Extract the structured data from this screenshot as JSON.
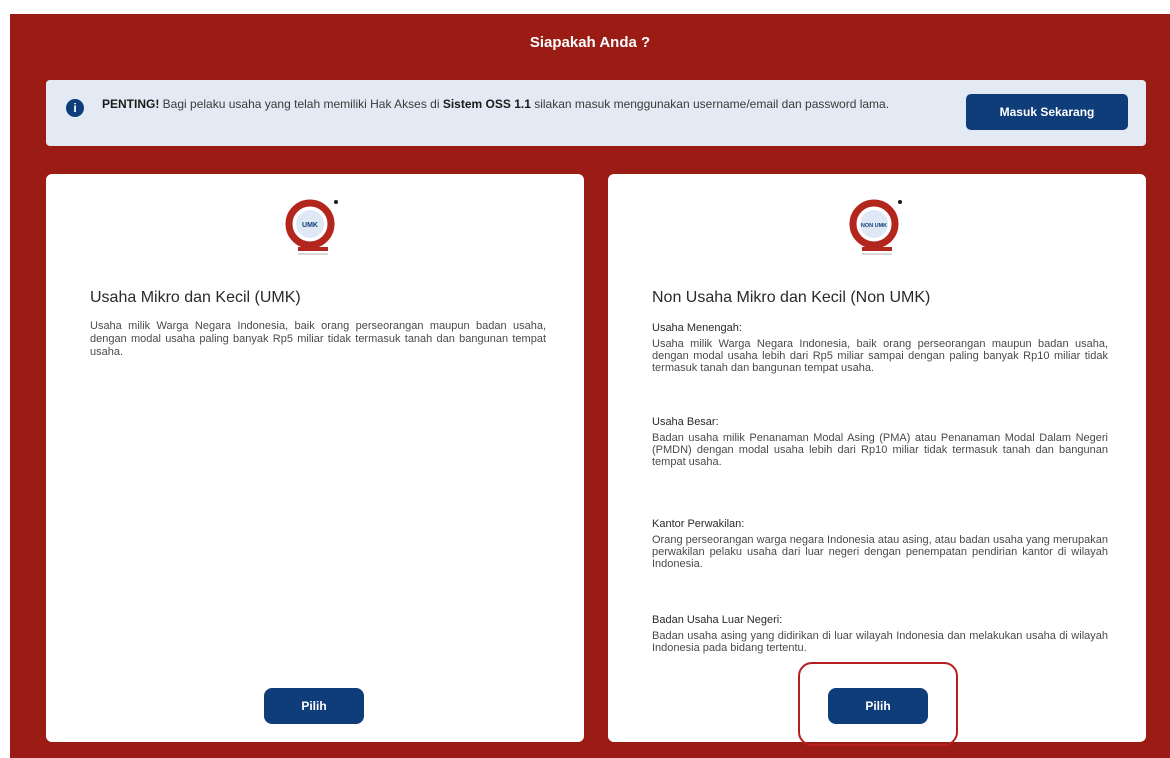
{
  "header": {
    "title": "Siapakah Anda ?"
  },
  "notice": {
    "icon": "info-icon",
    "prefix": "PENTING!",
    "text_before": " Bagi pelaku usaha yang telah memiliki Hak Akses di ",
    "system_name": "Sistem OSS 1.1",
    "text_after": " silakan masuk menggunakan username/email dan password lama.",
    "button_label": "Masuk Sekarang"
  },
  "cards": [
    {
      "logo": "umk-logo",
      "logo_text": "UMK",
      "title": "Usaha Mikro dan Kecil (UMK)",
      "description": "Usaha milik Warga Negara Indonesia, baik orang perseorangan maupun badan usaha, dengan modal usaha paling banyak Rp5 miliar tidak termasuk tanah dan bangunan tempat usaha.",
      "button_label": "Pilih"
    },
    {
      "logo": "non-umk-logo",
      "logo_text": "NON UMK",
      "title": "Non Usaha Mikro dan Kecil (Non UMK)",
      "sections": [
        {
          "heading": "Usaha Menengah:",
          "text": "Usaha milik Warga Negara Indonesia, baik orang perseorangan maupun badan usaha, dengan modal usaha lebih dari Rp5 miliar sampai dengan paling banyak Rp10 miliar tidak termasuk tanah dan bangunan tempat usaha."
        },
        {
          "heading": "Usaha Besar:",
          "text": "Badan usaha milik Penanaman Modal Asing (PMA) atau Penanaman Modal Dalam Negeri (PMDN) dengan modal usaha lebih dari Rp10 miliar tidak termasuk tanah dan bangunan tempat usaha."
        },
        {
          "heading": "Kantor Perwakilan:",
          "text": "Orang perseorangan warga negara Indonesia atau asing, atau badan usaha yang merupakan perwakilan pelaku usaha dari luar negeri dengan penempatan pendirian kantor di wilayah Indonesia."
        },
        {
          "heading": "Badan Usaha Luar Negeri:",
          "text": "Badan usaha asing yang didirikan di luar wilayah Indonesia dan melakukan usaha di wilayah Indonesia pada bidang tertentu."
        }
      ],
      "button_label": "Pilih"
    }
  ]
}
